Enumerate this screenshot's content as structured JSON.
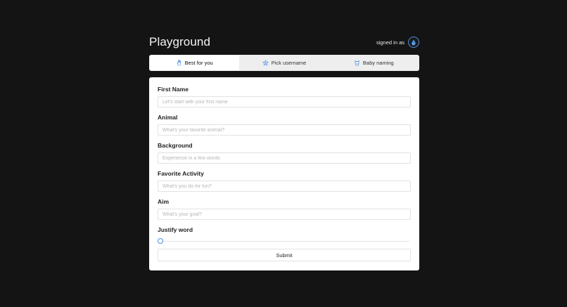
{
  "app": {
    "title": "Playground",
    "signed_in_label": "signed in as",
    "avatar_icon": "drop-icon",
    "accent_color": "#4a8fe0"
  },
  "tabs": [
    {
      "label": "Best for you",
      "icon": "hand-icon",
      "active": true
    },
    {
      "label": "Pick username",
      "icon": "star-badge-icon",
      "active": false
    },
    {
      "label": "Baby naming",
      "icon": "baby-icon",
      "active": false
    }
  ],
  "form": {
    "fields": [
      {
        "label": "First Name",
        "placeholder": "Let's start with your first name",
        "value": ""
      },
      {
        "label": "Animal",
        "placeholder": "What's your favorite animal?",
        "value": ""
      },
      {
        "label": "Background",
        "placeholder": "Experience in a few words",
        "value": ""
      },
      {
        "label": "Favorite Activity",
        "placeholder": "What's you do for fun?",
        "value": ""
      },
      {
        "label": "Aim",
        "placeholder": "What's your goal?",
        "value": ""
      }
    ],
    "slider": {
      "label": "Justify word",
      "value": 0
    },
    "submit_label": "Submit"
  }
}
